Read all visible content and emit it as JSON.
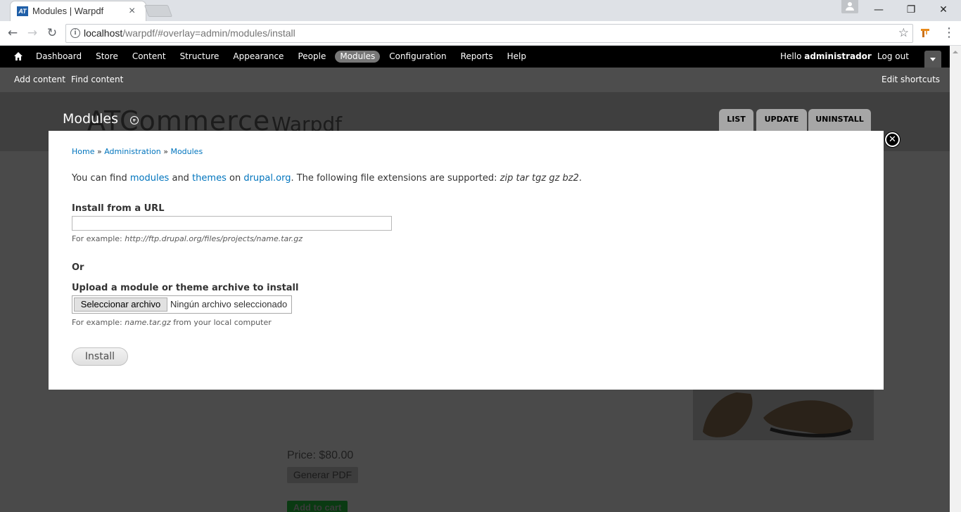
{
  "browser": {
    "tab_title": "Modules | Warpdf",
    "tab_favicon": "AT",
    "url_host": "localhost",
    "url_path": "/warpdf/#overlay=admin/modules/install",
    "window_buttons": {
      "minimize": "—",
      "restore": "❐",
      "close": "✕"
    }
  },
  "toolbar": {
    "menu": [
      "Dashboard",
      "Store",
      "Content",
      "Structure",
      "Appearance",
      "People",
      "Modules",
      "Configuration",
      "Reports",
      "Help"
    ],
    "active_item": "Modules",
    "hello_prefix": "Hello ",
    "username": "administrador",
    "logout": "Log out",
    "shortcuts": [
      "Add content",
      "Find content"
    ],
    "edit_shortcuts": "Edit shortcuts"
  },
  "background_page": {
    "site_name": "ATCommerce",
    "site_slogan": "Warpdf",
    "price": "Price: $80.00",
    "generate_pdf": "Generar PDF",
    "add_to_cart": "Add to cart"
  },
  "overlay": {
    "title": "Modules",
    "tabs": [
      "LIST",
      "UPDATE",
      "UNINSTALL"
    ],
    "close": "✕",
    "breadcrumb": {
      "home": "Home",
      "sep": " » ",
      "admin": "Administration",
      "modules": "Modules"
    },
    "intro": {
      "p1": "You can find ",
      "modules_link": "modules",
      "p2": " and ",
      "themes_link": "themes",
      "p3": " on ",
      "drupal_link": "drupal.org",
      "p4": ". The following file extensions are supported: ",
      "extensions": "zip tar tgz gz bz2",
      "p5": "."
    },
    "install_url_label": "Install from a URL",
    "install_url_value": "",
    "url_example_prefix": "For example: ",
    "url_example": "http://ftp.drupal.org/files/projects/name.tar.gz",
    "or_label": "Or",
    "upload_label": "Upload a module or theme archive to install",
    "file_button": "Seleccionar archivo",
    "file_status": "Ningún archivo seleccionado",
    "upload_example_prefix": "For example: ",
    "upload_example": "name.tar.gz",
    "upload_example_suffix": " from your local computer",
    "install_button": "Install"
  }
}
